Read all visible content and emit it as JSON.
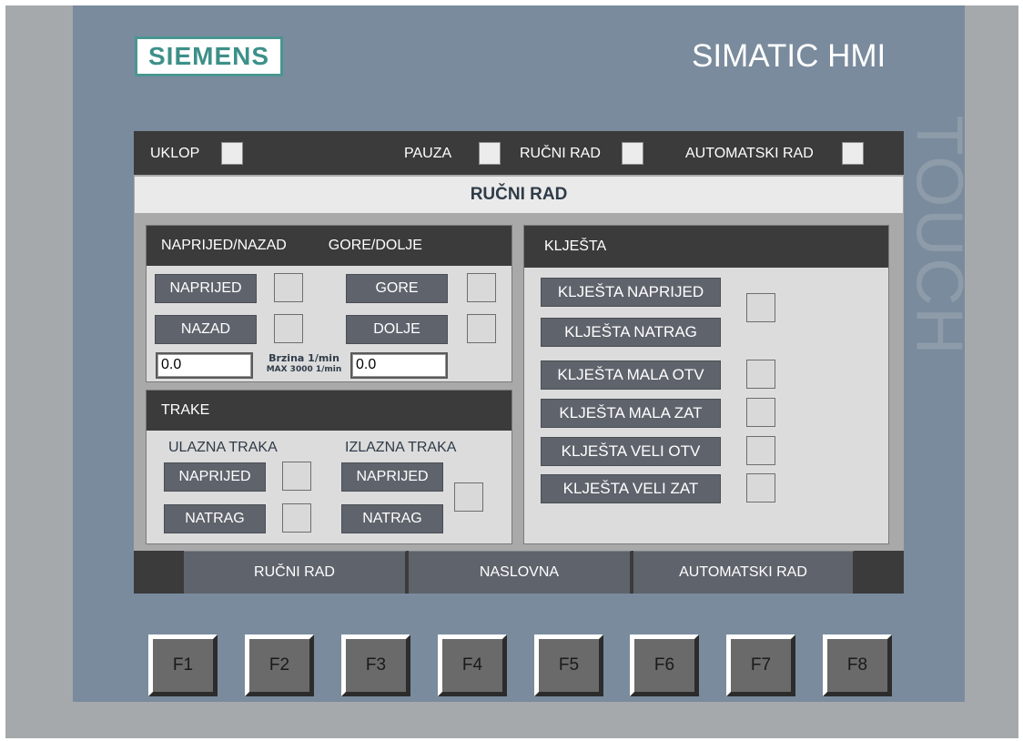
{
  "header": {
    "brand": "SIEMENS",
    "product": "SIMATIC HMI",
    "touch": "TOUCH"
  },
  "status": {
    "uklop": "UKLOP",
    "pauza": "PAUZA",
    "rucni_rad": "RUČNI RAD",
    "automatski_rad": "AUTOMATSKI RAD"
  },
  "screen_title": "RUČNI RAD",
  "motion_panel": {
    "header_left": "NAPRIJED/NAZAD",
    "header_right": "GORE/DOLJE",
    "naprijed": "NAPRIJED",
    "nazad": "NAZAD",
    "gore": "GORE",
    "dolje": "DOLJE",
    "speed_left_value": "0.0",
    "speed_right_value": "0.0",
    "speed_label": "Brzina 1/min",
    "speed_max": "MAX 3000 1/min"
  },
  "trake_panel": {
    "header": "TRAKE",
    "ulazna_label": "ULAZNA TRAKA",
    "izlazna_label": "IZLAZNA TRAKA",
    "ulazna_naprijed": "NAPRIJED",
    "ulazna_natrag": "NATRAG",
    "izlazna_naprijed": "NAPRIJED",
    "izlazna_natrag": "NATRAG"
  },
  "kljesta_panel": {
    "header": "KLJEŠTA",
    "naprijed": "KLJEŠTA NAPRIJED",
    "natrag": "KLJEŠTA NATRAG",
    "mala_otv": "KLJEŠTA MALA OTV",
    "mala_zat": "KLJEŠTA MALA ZAT",
    "veli_otv": "KLJEŠTA VELI OTV",
    "veli_zat": "KLJEŠTA VELI ZAT"
  },
  "nav": {
    "rucni_rad": "RUČNI RAD",
    "naslovna": "NASLOVNA",
    "automatski_rad": "AUTOMATSKI RAD"
  },
  "function_keys": [
    "F1",
    "F2",
    "F3",
    "F4",
    "F5",
    "F6",
    "F7",
    "F8"
  ],
  "colors": {
    "bezel": "#7a8b9d",
    "screen_bar": "#3b3b3b",
    "button": "#5f636c",
    "panel": "#dcdcdc",
    "brand_teal": "#3d9089"
  }
}
